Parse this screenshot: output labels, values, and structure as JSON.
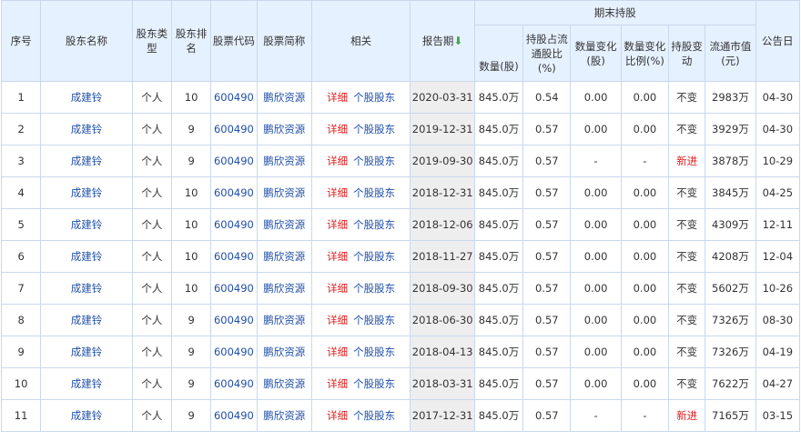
{
  "header": {
    "seq": "序号",
    "holder_name": "股东名称",
    "holder_type": "股东类型",
    "holder_rank": "股东排名",
    "stock_code": "股票代码",
    "stock_abbr": "股票简称",
    "related": "相关",
    "report_date": "报告期",
    "sort_icon": "down-arrow-icon",
    "period_end_group": "期末持股",
    "quantity": "数量(股)",
    "float_ratio": "持股占流通股比(%)",
    "qty_change": "数量变化(股)",
    "qty_change_ratio": "数量变化比例(%)",
    "holding_change": "持股变动",
    "float_market_value": "流通市值(元)",
    "announce_date": "公告日"
  },
  "rows": [
    {
      "seq": "1",
      "name": "成建铃",
      "type": "个人",
      "rank": "10",
      "code": "600490",
      "abbr": "鹏欣资源",
      "detail": "详细",
      "holders": "个股股东",
      "date": "2020-03-31",
      "qty": "845.0万",
      "ratio": "0.54",
      "chg": "0.00",
      "chg_ratio": "0.00",
      "status": "不变",
      "mv": "2983万",
      "ann": "04-30"
    },
    {
      "seq": "2",
      "name": "成建铃",
      "type": "个人",
      "rank": "9",
      "code": "600490",
      "abbr": "鹏欣资源",
      "detail": "详细",
      "holders": "个股股东",
      "date": "2019-12-31",
      "qty": "845.0万",
      "ratio": "0.57",
      "chg": "0.00",
      "chg_ratio": "0.00",
      "status": "不变",
      "mv": "3929万",
      "ann": "04-30"
    },
    {
      "seq": "3",
      "name": "成建铃",
      "type": "个人",
      "rank": "9",
      "code": "600490",
      "abbr": "鹏欣资源",
      "detail": "详细",
      "holders": "个股股东",
      "date": "2019-09-30",
      "qty": "845.0万",
      "ratio": "0.57",
      "chg": "-",
      "chg_ratio": "-",
      "status": "新进",
      "mv": "3878万",
      "ann": "10-29"
    },
    {
      "seq": "4",
      "name": "成建铃",
      "type": "个人",
      "rank": "10",
      "code": "600490",
      "abbr": "鹏欣资源",
      "detail": "详细",
      "holders": "个股股东",
      "date": "2018-12-31",
      "qty": "845.0万",
      "ratio": "0.57",
      "chg": "0.00",
      "chg_ratio": "0.00",
      "status": "不变",
      "mv": "3845万",
      "ann": "04-25"
    },
    {
      "seq": "5",
      "name": "成建铃",
      "type": "个人",
      "rank": "10",
      "code": "600490",
      "abbr": "鹏欣资源",
      "detail": "详细",
      "holders": "个股股东",
      "date": "2018-12-06",
      "qty": "845.0万",
      "ratio": "0.57",
      "chg": "0.00",
      "chg_ratio": "0.00",
      "status": "不变",
      "mv": "4309万",
      "ann": "12-11"
    },
    {
      "seq": "6",
      "name": "成建铃",
      "type": "个人",
      "rank": "10",
      "code": "600490",
      "abbr": "鹏欣资源",
      "detail": "详细",
      "holders": "个股股东",
      "date": "2018-11-27",
      "qty": "845.0万",
      "ratio": "0.57",
      "chg": "0.00",
      "chg_ratio": "0.00",
      "status": "不变",
      "mv": "4208万",
      "ann": "12-04"
    },
    {
      "seq": "7",
      "name": "成建铃",
      "type": "个人",
      "rank": "10",
      "code": "600490",
      "abbr": "鹏欣资源",
      "detail": "详细",
      "holders": "个股股东",
      "date": "2018-09-30",
      "qty": "845.0万",
      "ratio": "0.57",
      "chg": "0.00",
      "chg_ratio": "0.00",
      "status": "不变",
      "mv": "5602万",
      "ann": "10-26"
    },
    {
      "seq": "8",
      "name": "成建铃",
      "type": "个人",
      "rank": "9",
      "code": "600490",
      "abbr": "鹏欣资源",
      "detail": "详细",
      "holders": "个股股东",
      "date": "2018-06-30",
      "qty": "845.0万",
      "ratio": "0.57",
      "chg": "0.00",
      "chg_ratio": "0.00",
      "status": "不变",
      "mv": "7326万",
      "ann": "08-30"
    },
    {
      "seq": "9",
      "name": "成建铃",
      "type": "个人",
      "rank": "9",
      "code": "600490",
      "abbr": "鹏欣资源",
      "detail": "详细",
      "holders": "个股股东",
      "date": "2018-04-13",
      "qty": "845.0万",
      "ratio": "0.57",
      "chg": "0.00",
      "chg_ratio": "0.00",
      "status": "不变",
      "mv": "7326万",
      "ann": "04-19"
    },
    {
      "seq": "10",
      "name": "成建铃",
      "type": "个人",
      "rank": "9",
      "code": "600490",
      "abbr": "鹏欣资源",
      "detail": "详细",
      "holders": "个股股东",
      "date": "2018-03-31",
      "qty": "845.0万",
      "ratio": "0.57",
      "chg": "0.00",
      "chg_ratio": "0.00",
      "status": "不变",
      "mv": "7622万",
      "ann": "04-27"
    },
    {
      "seq": "11",
      "name": "成建铃",
      "type": "个人",
      "rank": "9",
      "code": "600490",
      "abbr": "鹏欣资源",
      "detail": "详细",
      "holders": "个股股东",
      "date": "2017-12-31",
      "qty": "845.0万",
      "ratio": "0.57",
      "chg": "-",
      "chg_ratio": "-",
      "status": "新进",
      "mv": "7165万",
      "ann": "03-15"
    }
  ],
  "colors": {
    "header_bg": "#e6f1ff",
    "border": "#c9d8ee",
    "link_blue": "#1f4fa8",
    "detail_red": "#e01e1e",
    "new_entry_red": "#e01e1e",
    "sorted_col_bg": "#eeeeee",
    "sort_arrow_green": "#38a84a"
  }
}
